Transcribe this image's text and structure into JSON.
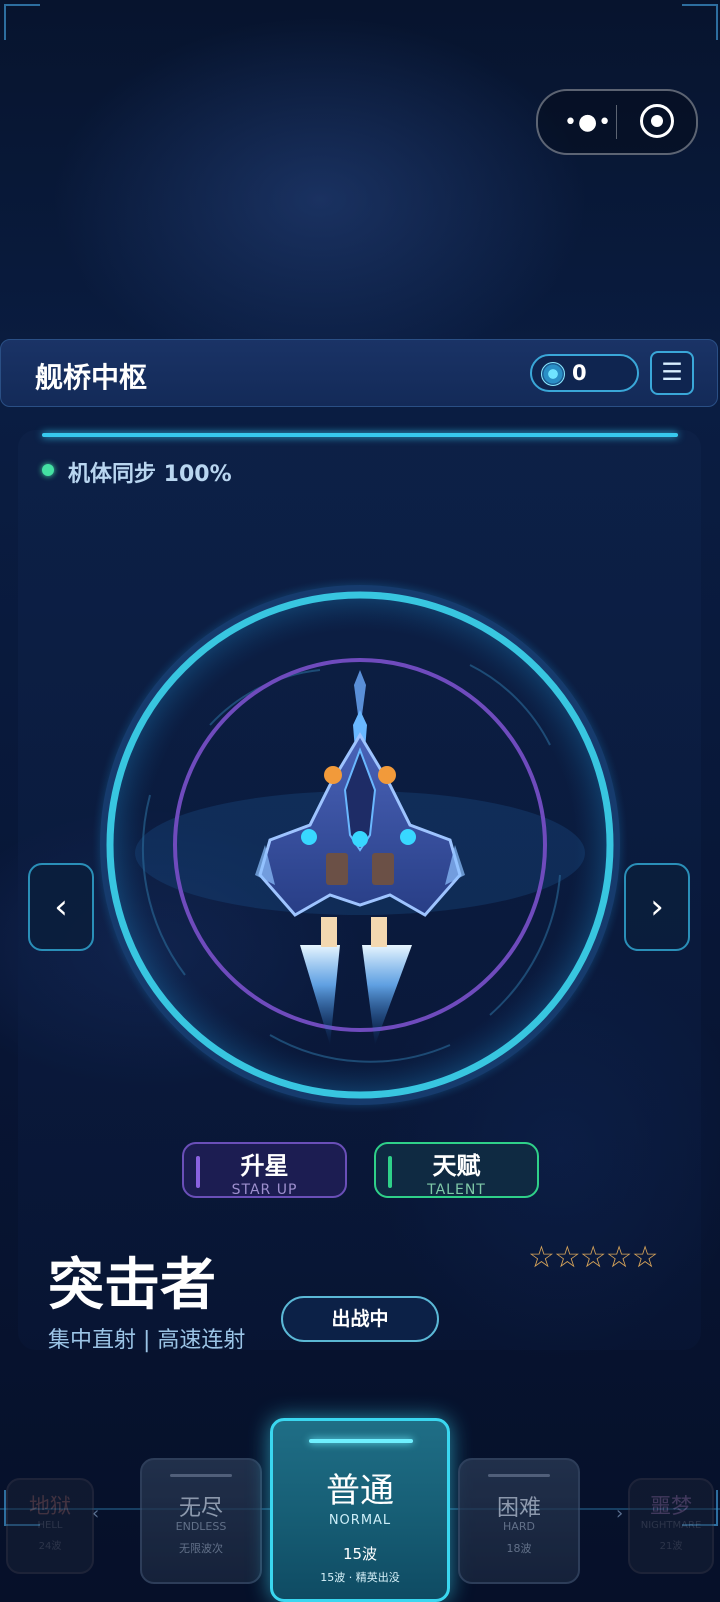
{
  "header": {
    "title": "舰桥中枢",
    "coin_value": "0",
    "menu_icon": "menu-icon"
  },
  "sync": {
    "label": "机体同步 100%",
    "value_percent": 100
  },
  "ship": {
    "name": "突击者",
    "description": "集中直射 | 高速连射",
    "stars": "☆☆☆☆☆",
    "star_rating": 0,
    "star_max": 5,
    "status_label": "出战中"
  },
  "actions": {
    "star_up": {
      "label": "升星",
      "sub": "STAR UP"
    },
    "talent": {
      "label": "天赋",
      "sub": "TALENT"
    }
  },
  "nav": {
    "prev": "‹",
    "next": "›"
  },
  "difficulties": {
    "hell": {
      "name": "地狱",
      "en": "HELL",
      "waves": "24波"
    },
    "endless": {
      "name": "无尽",
      "en": "ENDLESS",
      "waves": "无限波次"
    },
    "normal": {
      "name": "普通",
      "en": "NORMAL",
      "waves": "15波",
      "detail": "15波 · 精英出没"
    },
    "hard": {
      "name": "困难",
      "en": "HARD",
      "waves": "18波"
    },
    "nightmare": {
      "name": "噩梦",
      "en": "NIGHTMARE",
      "waves": "21波"
    },
    "arrow_left": "‹",
    "arrow_right": "›"
  },
  "colors": {
    "accent_cyan": "#37c9ee",
    "accent_purple": "#7a4fc8",
    "accent_green": "#2fd089",
    "star_gold": "#d7a45a"
  }
}
